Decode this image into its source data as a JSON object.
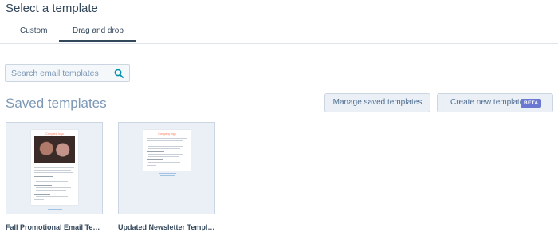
{
  "page": {
    "title": "Select a template"
  },
  "tabs": [
    {
      "label": "Custom",
      "selected": false
    },
    {
      "label": "Drag and drop",
      "selected": true
    }
  ],
  "search": {
    "placeholder": "Search email templates",
    "value": ""
  },
  "section": {
    "title": "Saved templates"
  },
  "buttons": {
    "manage_label": "Manage saved templates",
    "create_label": "Create new template",
    "beta_badge": "BETA"
  },
  "templates": [
    {
      "name": "Fall Promotional Email Tem…",
      "logo_text": "Company logo"
    },
    {
      "name": "Updated Newsletter Templ…",
      "logo_text": "Company logo"
    }
  ],
  "colors": {
    "accent": "#33475b",
    "beta": "#6a78d1",
    "card_bg": "#eaf0f6",
    "logo": "#ff7a59"
  }
}
